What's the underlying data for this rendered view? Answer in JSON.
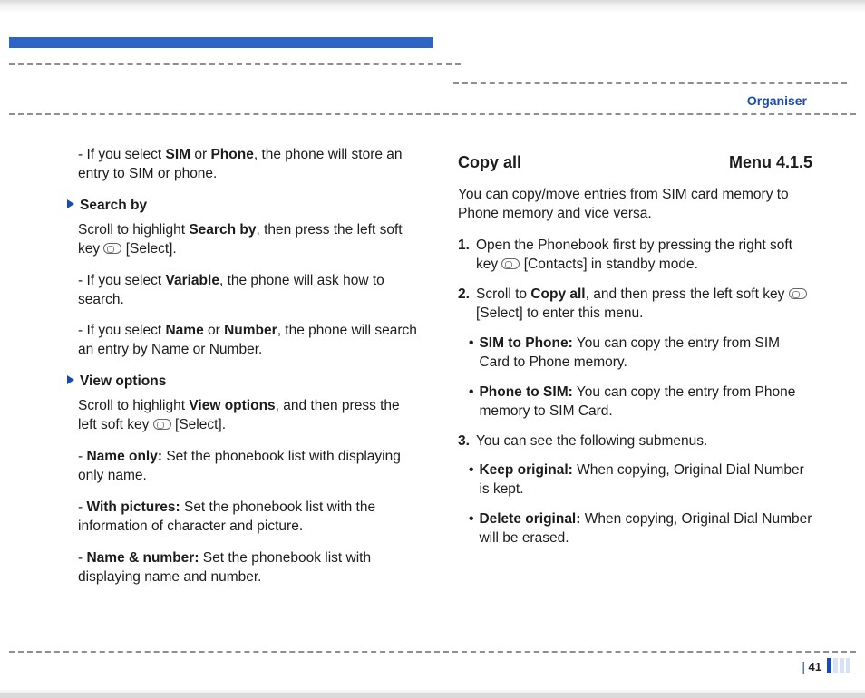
{
  "sectionLabel": "Organiser",
  "left": {
    "li1": {
      "dash": "- If you select ",
      "b1": "SIM",
      "mid": " or ",
      "b2": "Phone",
      "rest": ", the phone will store an entry to SIM or phone."
    },
    "h1": "Search by",
    "p1": {
      "a": "Scroll to highlight ",
      "b": "Search by",
      "c": ", then press the left soft key ",
      "d": " [Select]."
    },
    "li2": {
      "a": "- If you select ",
      "b": "Variable",
      "c": ", the phone will ask how to search."
    },
    "li3": {
      "a": "- If you select ",
      "b1": "Name",
      "mid": " or ",
      "b2": "Number",
      "c": ", the phone will search an entry by Name or Number."
    },
    "h2": "View options",
    "p2": {
      "a": "Scroll to highlight ",
      "b": "View options",
      "c": ", and then press the left soft key ",
      "d": " [Select]."
    },
    "li4": {
      "dash": "- ",
      "b": "Name only:",
      "rest": " Set the phonebook list with displaying only name."
    },
    "li5": {
      "dash": "- ",
      "b": "With pictures:",
      "rest": " Set the phonebook list with the information of character and picture."
    },
    "li6": {
      "dash": "- ",
      "b": "Name & number:",
      "rest": " Set the phonebook list with displaying name and number."
    }
  },
  "right": {
    "title": "Copy all",
    "menu": "Menu 4.1.5",
    "intro": "You can copy/move entries from SIM card memory to Phone memory and vice versa.",
    "s1": {
      "n": "1.",
      "a": "Open the Phonebook first by pressing the right soft key ",
      "b": " [Contacts] in standby mode."
    },
    "s2": {
      "n": "2.",
      "a": "Scroll to ",
      "b": "Copy all",
      "c": ", and then press the left soft key ",
      "d": " [Select] to enter this menu."
    },
    "s2a": {
      "b": "SIM to Phone:",
      "rest": " You can copy the entry from SIM Card to Phone memory."
    },
    "s2b": {
      "b": "Phone to SIM:",
      "rest": " You can copy the entry from Phone memory to SIM Card."
    },
    "s3": {
      "n": "3.",
      "a": "You can see the following submenus."
    },
    "s3a": {
      "b": "Keep original:",
      "rest": " When copying, Original Dial Number is kept."
    },
    "s3b": {
      "b": "Delete original:",
      "rest": " When copying, Original Dial Number will be erased."
    }
  },
  "pageNumber": "41"
}
